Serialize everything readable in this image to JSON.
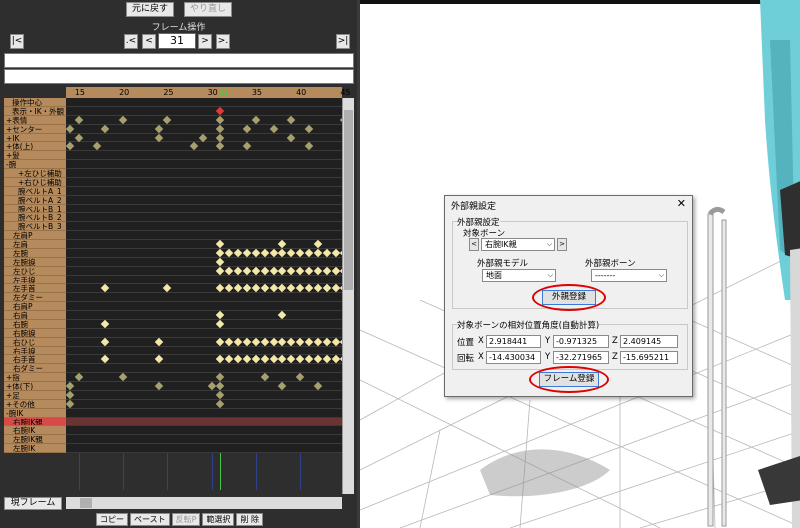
{
  "toolbar": {
    "undo_label": "元に戻す",
    "redo_label": "やり直し"
  },
  "frame_op": {
    "title": "フレーム操作",
    "first_label": "|<",
    "prev_key_label": ".<",
    "prev_label": "<",
    "frame_value": "31",
    "next_label": ">",
    "next_key_label": ">.",
    "last_label": ">|"
  },
  "timeline": {
    "ruler_ticks": [
      "15",
      "20",
      "25",
      "30",
      "31",
      "35",
      "40",
      "45"
    ],
    "current_frame": "31",
    "rows": [
      {
        "label": "操作中心"
      },
      {
        "label": "表示・IK・外観"
      },
      {
        "label": "+表情"
      },
      {
        "label": "+センター"
      },
      {
        "label": "+IK"
      },
      {
        "label": "+体(上)"
      },
      {
        "label": "+髪"
      },
      {
        "label": "-腕"
      },
      {
        "label": "+左ひじ補助"
      },
      {
        "label": "+右ひじ補助"
      },
      {
        "label": "腕ベルトA_1"
      },
      {
        "label": "腕ベルトA_2"
      },
      {
        "label": "腕ベルトB_1"
      },
      {
        "label": "腕ベルトB_2"
      },
      {
        "label": "腕ベルトB_3"
      },
      {
        "label": "左肩P"
      },
      {
        "label": "左肩"
      },
      {
        "label": "左腕"
      },
      {
        "label": "左腕捩"
      },
      {
        "label": "左ひじ"
      },
      {
        "label": "左手捩"
      },
      {
        "label": "左手首"
      },
      {
        "label": "左ダミー"
      },
      {
        "label": "右肩P"
      },
      {
        "label": "右肩"
      },
      {
        "label": "右腕"
      },
      {
        "label": "右腕捩"
      },
      {
        "label": "右ひじ"
      },
      {
        "label": "右手捩"
      },
      {
        "label": "右手首"
      },
      {
        "label": "右ダミー"
      },
      {
        "label": "+指"
      },
      {
        "label": "+体(下)"
      },
      {
        "label": "+足"
      },
      {
        "label": "+その他"
      },
      {
        "label": "-腕IK"
      },
      {
        "label": "右腕IK親"
      },
      {
        "label": "右腕IK"
      },
      {
        "label": "左腕IK親"
      },
      {
        "label": "左腕IK"
      }
    ],
    "current_frame_label": "現フレーム"
  },
  "bottom_bar": [
    "コピー",
    "ペースト",
    "反転P",
    "範選択",
    "削 除"
  ],
  "dialog": {
    "title": "外部親設定",
    "close_label": "✕",
    "group1_label": "外部親設定",
    "target_bone_label": "対象ボーン",
    "target_bone_value": "右腕IK親",
    "ext_model_label": "外部親モデル",
    "ext_model_value": "地面",
    "ext_bone_label": "外部親ボーン",
    "ext_bone_value": "-------",
    "register_parent_label": "外親登録",
    "group2_label": "対象ボーンの相対位置角度(自動計算)",
    "pos_label": "位置",
    "rot_label": "回転",
    "axis_x": "X",
    "axis_y": "Y",
    "axis_z": "Z",
    "pos_x": "2.918441",
    "pos_y": "-0.971325",
    "pos_z": "2.409145",
    "rot_x": "-14.430034",
    "rot_y": "-32.271965",
    "rot_z": "-15.695211",
    "register_frame_label": "フレーム登録"
  },
  "colors": {
    "accent_ring": "#e00000",
    "key_white": "#f4e8a8",
    "key_olive": "#a6a06e",
    "key_selected": "#e23a3a",
    "label_bg": "#b58a5c"
  }
}
